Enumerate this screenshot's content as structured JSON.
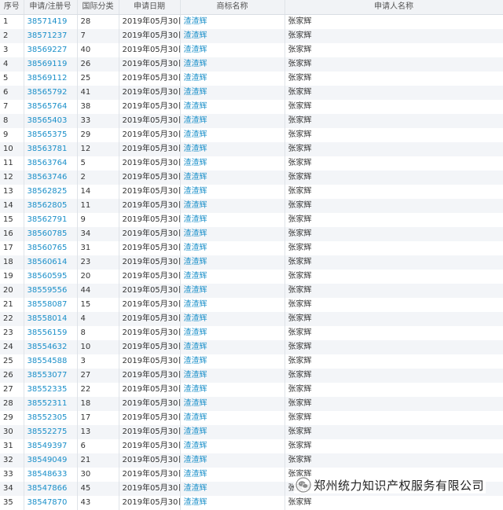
{
  "table": {
    "headers": [
      "序号",
      "申请/注册号",
      "国际分类",
      "申请日期",
      "商标名称",
      "申请人名称"
    ],
    "rows": [
      [
        "1",
        "38571419",
        "28",
        "2019年05月30日",
        "渣渣辉",
        "张家辉"
      ],
      [
        "2",
        "38571237",
        "7",
        "2019年05月30日",
        "渣渣辉",
        "张家辉"
      ],
      [
        "3",
        "38569227",
        "40",
        "2019年05月30日",
        "渣渣辉",
        "张家辉"
      ],
      [
        "4",
        "38569119",
        "26",
        "2019年05月30日",
        "渣渣辉",
        "张家辉"
      ],
      [
        "5",
        "38569112",
        "25",
        "2019年05月30日",
        "渣渣辉",
        "张家辉"
      ],
      [
        "6",
        "38565792",
        "41",
        "2019年05月30日",
        "渣渣辉",
        "张家辉"
      ],
      [
        "7",
        "38565764",
        "38",
        "2019年05月30日",
        "渣渣辉",
        "张家辉"
      ],
      [
        "8",
        "38565403",
        "33",
        "2019年05月30日",
        "渣渣辉",
        "张家辉"
      ],
      [
        "9",
        "38565375",
        "29",
        "2019年05月30日",
        "渣渣辉",
        "张家辉"
      ],
      [
        "10",
        "38563781",
        "12",
        "2019年05月30日",
        "渣渣辉",
        "张家辉"
      ],
      [
        "11",
        "38563764",
        "5",
        "2019年05月30日",
        "渣渣辉",
        "张家辉"
      ],
      [
        "12",
        "38563746",
        "2",
        "2019年05月30日",
        "渣渣辉",
        "张家辉"
      ],
      [
        "13",
        "38562825",
        "14",
        "2019年05月30日",
        "渣渣辉",
        "张家辉"
      ],
      [
        "14",
        "38562805",
        "11",
        "2019年05月30日",
        "渣渣辉",
        "张家辉"
      ],
      [
        "15",
        "38562791",
        "9",
        "2019年05月30日",
        "渣渣辉",
        "张家辉"
      ],
      [
        "16",
        "38560785",
        "34",
        "2019年05月30日",
        "渣渣辉",
        "张家辉"
      ],
      [
        "17",
        "38560765",
        "31",
        "2019年05月30日",
        "渣渣辉",
        "张家辉"
      ],
      [
        "18",
        "38560614",
        "23",
        "2019年05月30日",
        "渣渣辉",
        "张家辉"
      ],
      [
        "19",
        "38560595",
        "20",
        "2019年05月30日",
        "渣渣辉",
        "张家辉"
      ],
      [
        "20",
        "38559556",
        "44",
        "2019年05月30日",
        "渣渣辉",
        "张家辉"
      ],
      [
        "21",
        "38558087",
        "15",
        "2019年05月30日",
        "渣渣辉",
        "张家辉"
      ],
      [
        "22",
        "38558014",
        "4",
        "2019年05月30日",
        "渣渣辉",
        "张家辉"
      ],
      [
        "23",
        "38556159",
        "8",
        "2019年05月30日",
        "渣渣辉",
        "张家辉"
      ],
      [
        "24",
        "38554632",
        "10",
        "2019年05月30日",
        "渣渣辉",
        "张家辉"
      ],
      [
        "25",
        "38554588",
        "3",
        "2019年05月30日",
        "渣渣辉",
        "张家辉"
      ],
      [
        "26",
        "38553077",
        "27",
        "2019年05月30日",
        "渣渣辉",
        "张家辉"
      ],
      [
        "27",
        "38552335",
        "22",
        "2019年05月30日",
        "渣渣辉",
        "张家辉"
      ],
      [
        "28",
        "38552311",
        "18",
        "2019年05月30日",
        "渣渣辉",
        "张家辉"
      ],
      [
        "29",
        "38552305",
        "17",
        "2019年05月30日",
        "渣渣辉",
        "张家辉"
      ],
      [
        "30",
        "38552275",
        "13",
        "2019年05月30日",
        "渣渣辉",
        "张家辉"
      ],
      [
        "31",
        "38549397",
        "6",
        "2019年05月30日",
        "渣渣辉",
        "张家辉"
      ],
      [
        "32",
        "38549049",
        "21",
        "2019年05月30日",
        "渣渣辉",
        "张家辉"
      ],
      [
        "33",
        "38548633",
        "30",
        "2019年05月30日",
        "渣渣辉",
        "张家辉"
      ],
      [
        "34",
        "38547866",
        "45",
        "2019年05月30日",
        "渣渣辉",
        "张家辉"
      ],
      [
        "35",
        "38547870",
        "43",
        "2019年05月30日",
        "渣渣辉",
        "张家辉"
      ]
    ]
  },
  "watermark": {
    "text": "郑州统力知识产权服务有限公司",
    "icon": "wechat-logo-icon",
    "icon_color": "#8a8a8a"
  },
  "colors": {
    "link": "#1a8fc9",
    "header_bg": "#f1f3f6",
    "stripe_bg": "#f3f5f8"
  }
}
